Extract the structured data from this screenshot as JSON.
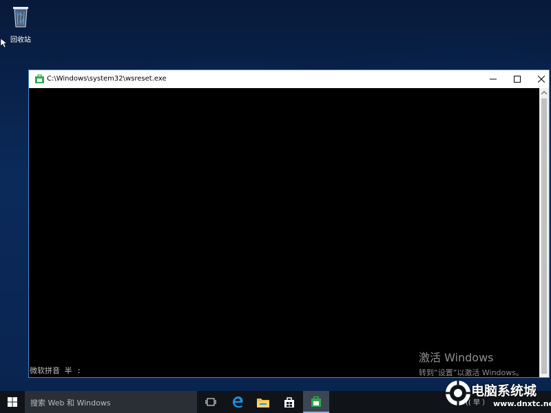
{
  "desktop": {
    "recycle_bin_label": "回收站"
  },
  "console_window": {
    "title": "C:\\Windows\\system32\\wsreset.exe",
    "ime_status": "微软拼音 半 :",
    "minimize_glyph": "—",
    "close_glyph": "✕"
  },
  "activation": {
    "line1": "激活 Windows",
    "line2": "转到“设置”以激活 Windows。"
  },
  "taskbar": {
    "search_placeholder": "搜索 Web 和 Windows",
    "icons": [
      "windows-start-icon",
      "task-view-icon",
      "edge-icon",
      "file-explorer-icon",
      "store-icon",
      "console-app-icon"
    ],
    "tray_text": "(( 早 ）"
  },
  "watermark": {
    "site_name": "电脑系统城",
    "site_url": "www.dnxtc.net"
  },
  "colors": {
    "taskbar": "#101418",
    "search_box": "#2a2f36",
    "window_border": "#4a87c8",
    "console_bg": "#000000",
    "store_green": "#2fa84f"
  }
}
